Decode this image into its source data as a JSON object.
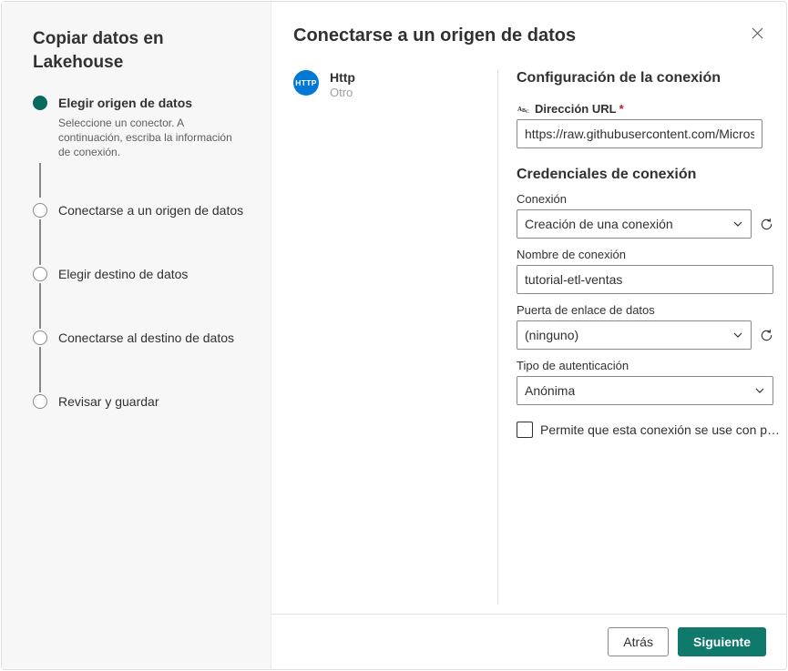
{
  "sidebar": {
    "title": "Copiar datos en Lakehouse",
    "steps": [
      {
        "title": "Elegir origen de datos",
        "desc": "Seleccione un conector. A continuación, escriba la información de conexión."
      },
      {
        "title": "Conectarse a un origen de datos"
      },
      {
        "title": "Elegir destino de datos"
      },
      {
        "title": "Conectarse al destino de datos"
      },
      {
        "title": "Revisar y guardar"
      }
    ]
  },
  "header": {
    "title": "Conectarse a un origen de datos"
  },
  "connector": {
    "icon_label": "HTTP",
    "name": "Http",
    "subtitle": "Otro"
  },
  "form": {
    "section_config": "Configuración de la conexión",
    "url_label": "Dirección URL",
    "url_value": "https://raw.githubusercontent.com/MicrosoftLearning",
    "section_credentials": "Credenciales de conexión",
    "connection_label": "Conexión",
    "connection_value": "Creación de una conexión",
    "conn_name_label": "Nombre de conexión",
    "conn_name_value": "tutorial-etl-ventas",
    "gateway_label": "Puerta de enlace de datos",
    "gateway_value": "(ninguno)",
    "auth_label": "Tipo de autenticación",
    "auth_value": "Anónima",
    "checkbox_label": "Permite que esta conexión se use con puert…"
  },
  "footer": {
    "back": "Atrás",
    "next": "Siguiente"
  }
}
